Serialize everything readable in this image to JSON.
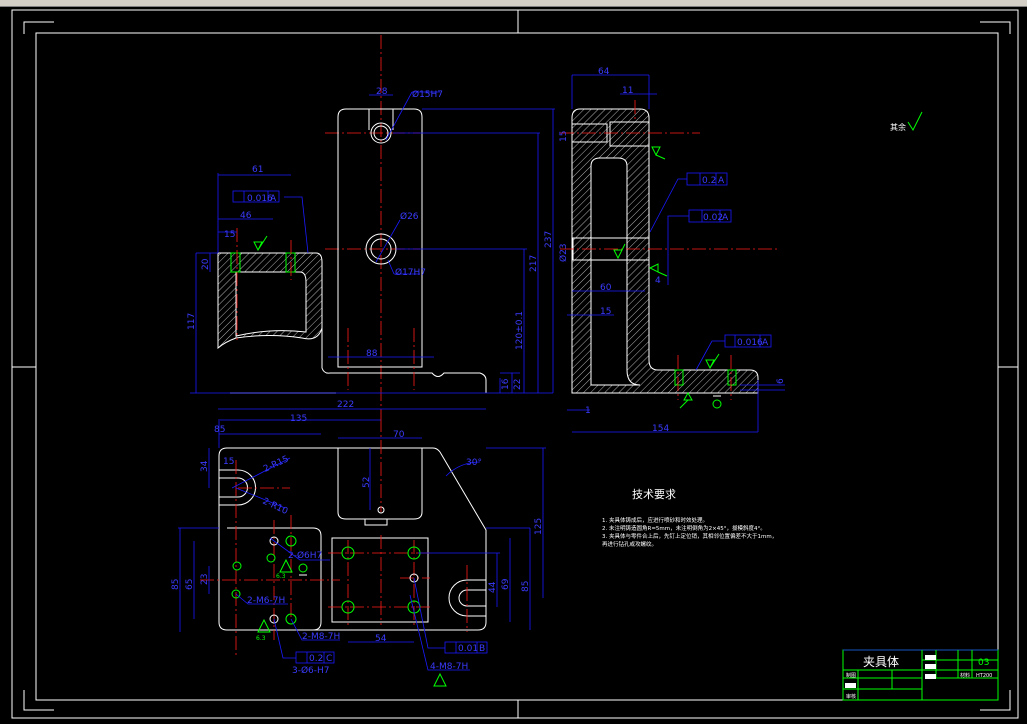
{
  "colors": {
    "background": "#000000",
    "outline": "#ffffff",
    "dimension": "#1a1aff",
    "centerline": "#ff1a1a",
    "surface_finish": "#00ff00"
  },
  "front_view": {
    "dims": [
      "28",
      "Ø15H7",
      "Ø26",
      "Ø17H7",
      "88",
      "222",
      "135",
      "16",
      "22",
      "120±0.1",
      "217",
      "237"
    ]
  },
  "section_view": {
    "dims": [
      "61",
      "0.016",
      "A",
      "46",
      "15",
      "20",
      "117"
    ]
  },
  "side_view": {
    "dims": [
      "64",
      "11",
      "15",
      "0.2",
      "A",
      "0.02",
      "A",
      "Ø23",
      "60",
      "15",
      "4",
      "0.016",
      "A",
      "6",
      "1",
      "154"
    ]
  },
  "bottom_view": {
    "dims": [
      "85",
      "70",
      "34",
      "15",
      "2-R15",
      "2-R10",
      "52",
      "30°",
      "125",
      "85",
      "65",
      "23",
      "2-Ø6H7",
      "2-M6-7H",
      "2-M8-7H",
      "54",
      "0.2",
      "C",
      "3-Ø6-H7",
      "0.01",
      "B",
      "4-M8-7H",
      "44",
      "69",
      "85",
      "6.3",
      "6.3"
    ]
  },
  "roughness_note": "其余",
  "tech_requirements": {
    "title": "技术要求",
    "lines": [
      "1. 夹具体铸成后，应进行喷砂和时效处理。",
      "2. 未注明铸造圆角R=5mm，未注明倒角为2×45°，拔模斜度4°。",
      "3. 夹具体与零件合上后，先钉上定位销，其相邻位置偏差不大于1mm，",
      "   再进行钻孔或攻螺纹。"
    ]
  },
  "title_block": {
    "part_name": "夹具体",
    "drawing_no": "03",
    "material_label": "材料",
    "material": "HT200",
    "drawn_label": "制图",
    "checked_label": "审核"
  }
}
